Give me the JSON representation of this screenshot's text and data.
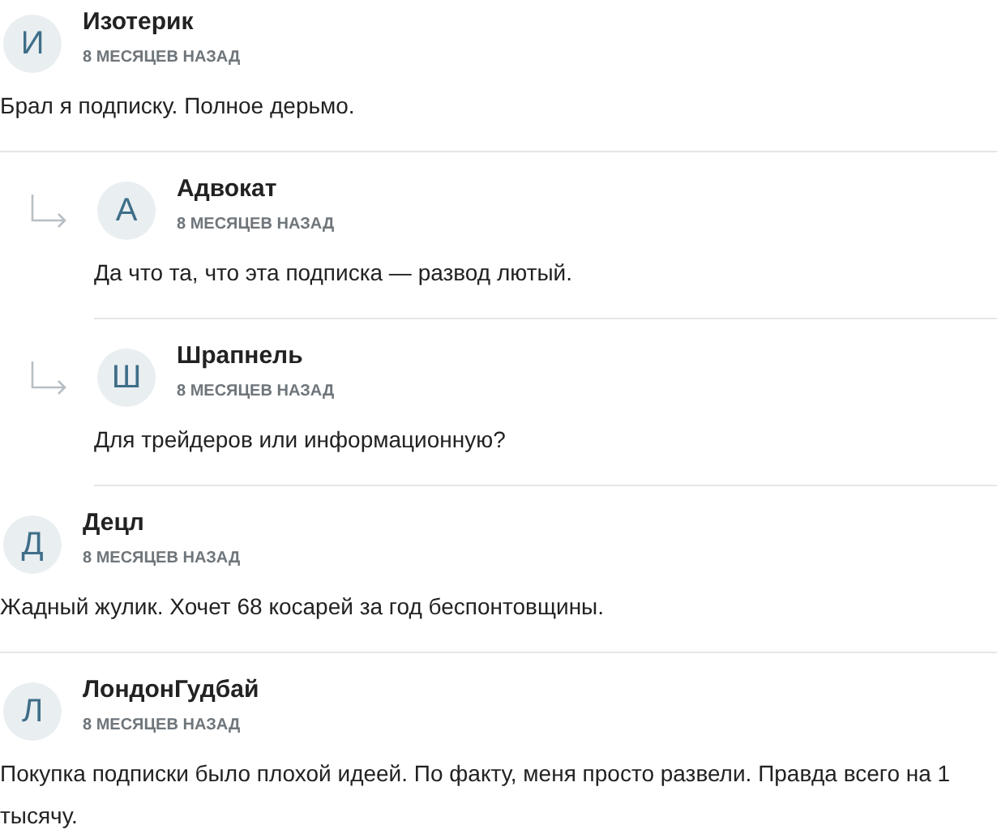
{
  "comments": [
    {
      "initial": "И",
      "author": "Изотерик",
      "time": "8 МЕСЯЦЕВ НАЗАД",
      "text": "Брал я подписку. Полное дерьмо.",
      "children": [
        {
          "initial": "А",
          "author": "Адвокат",
          "time": "8 МЕСЯЦЕВ НАЗАД",
          "text": "Да что та, что эта подписка — развод лютый."
        },
        {
          "initial": "Ш",
          "author": "Шрапнель",
          "time": "8 МЕСЯЦЕВ НАЗАД",
          "text": "Для трейдеров или информационную?"
        }
      ]
    },
    {
      "initial": "Д",
      "author": "Децл",
      "time": "8 МЕСЯЦЕВ НАЗАД",
      "text": "Жадный жулик. Хочет 68 косарей за год беспонтовщины."
    },
    {
      "initial": "Л",
      "author": "ЛондонГудбай",
      "time": "8 МЕСЯЦЕВ НАЗАД",
      "text": "Покупка подписки было плохой идеей. По факту, меня просто развели. Правда всего на 1 тысячу."
    }
  ]
}
